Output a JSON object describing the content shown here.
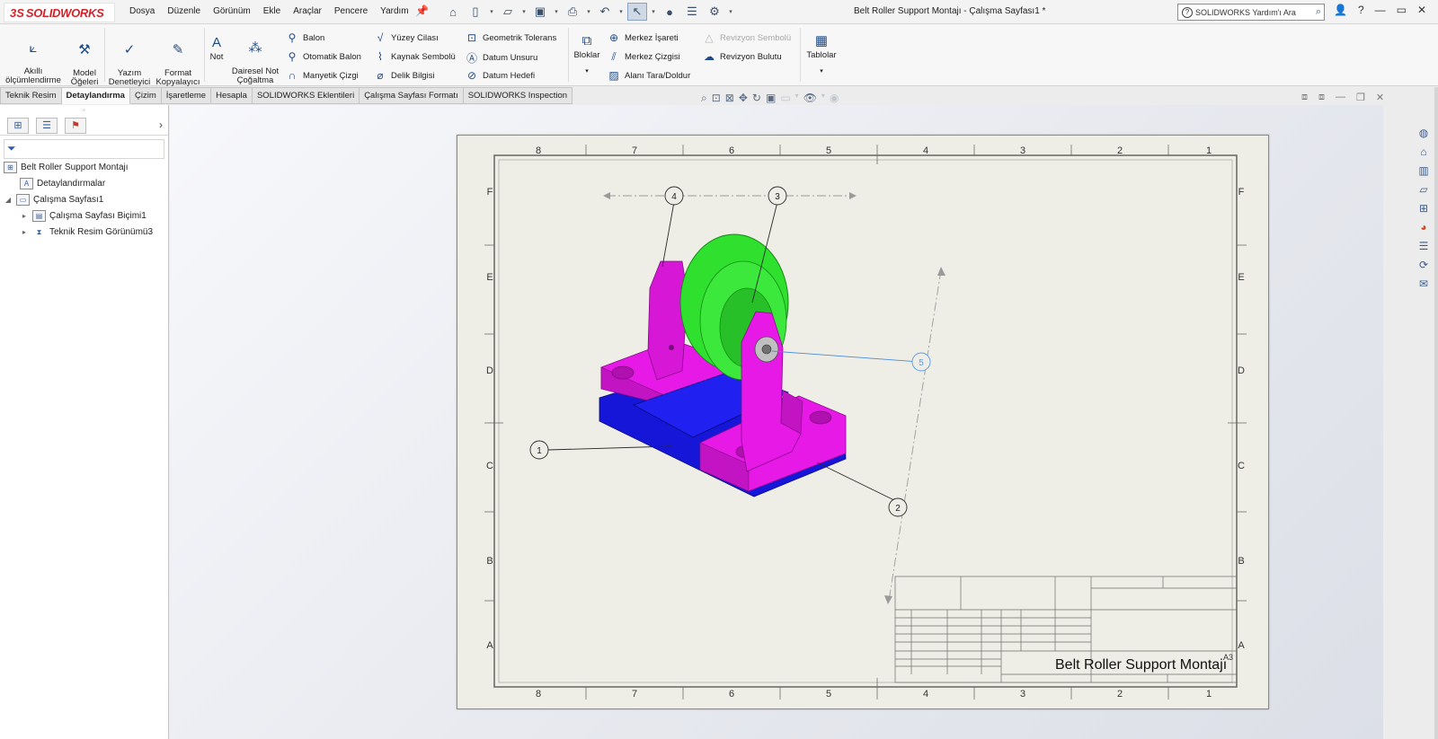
{
  "app": {
    "brand": "SOLIDWORKS",
    "document_title": "Belt Roller Support Montajı - Çalışma Sayfası1 *"
  },
  "menu": [
    "Dosya",
    "Düzenle",
    "Görünüm",
    "Ekle",
    "Araçlar",
    "Pencere",
    "Yardım"
  ],
  "help_search": {
    "placeholder": "SOLIDWORKS Yardım'ı Ara"
  },
  "ribbon": {
    "smart_dimension": "Akıllı\nölçümlendirme",
    "model_items": "Model\nÖğeleri",
    "spell_checker": "Yazım\nDenetleyici",
    "format_painter": "Format\nKopyalayıcı",
    "note": "Not",
    "linear_note_pattern": "Dairesel Not\nÇoğaltma",
    "balloon": "Balon",
    "auto_balloon": "Otomatik Balon",
    "magnetic_line": "Manyetik Çizgi",
    "surface_finish": "Yüzey Cilası",
    "weld_symbol": "Kaynak Sembolü",
    "hole_callout": "Delik Bilgisi",
    "geometric_tolerance": "Geometrik Tolerans",
    "datum_feature": "Datum Unsuru",
    "datum_target": "Datum Hedefi",
    "blocks": "Bloklar",
    "center_mark": "Merkez İşareti",
    "centerline": "Merkez Çizgisi",
    "area_hatch": "Alanı Tara/Doldur",
    "revision_symbol": "Revizyon Sembolü",
    "revision_cloud": "Revizyon Bulutu",
    "tables": "Tablolar"
  },
  "tabs": [
    {
      "label": "Teknik Resim",
      "active": false
    },
    {
      "label": "Detaylandırma",
      "active": true
    },
    {
      "label": "Çizim",
      "active": false
    },
    {
      "label": "İşaretleme",
      "active": false
    },
    {
      "label": "Hesapla",
      "active": false
    },
    {
      "label": "SOLIDWORKS Eklentileri",
      "active": false
    },
    {
      "label": "Çalışma Sayfası Formatı",
      "active": false
    },
    {
      "label": "SOLIDWORKS Inspection",
      "active": false
    }
  ],
  "tree": {
    "root": "Belt Roller Support Montajı",
    "annotations": "Detaylandırmalar",
    "sheet": "Çalışma Sayfası1",
    "sheet_format": "Çalışma Sayfası Biçimi1",
    "drawing_view": "Teknik Resim Görünümü3"
  },
  "sheet": {
    "col_labels": [
      "8",
      "7",
      "6",
      "5",
      "4",
      "3",
      "2",
      "1"
    ],
    "row_labels": [
      "F",
      "E",
      "D",
      "C",
      "B",
      "A"
    ],
    "balloons": [
      "1",
      "2",
      "3",
      "4",
      "5"
    ],
    "title_block_title": "Belt Roller Support Montajı",
    "sheet_size": "A3"
  },
  "colors": {
    "part_magenta": "#e619e6",
    "part_green": "#3be83b",
    "part_blue": "#1a1ae6",
    "sheet_bg": "#eeede6",
    "accent": "#1f4a87",
    "brand_red": "#d2232a"
  }
}
